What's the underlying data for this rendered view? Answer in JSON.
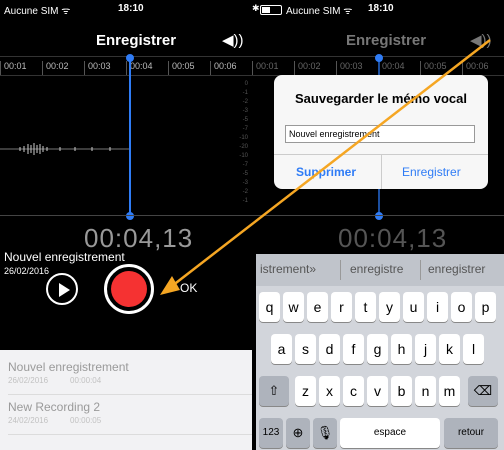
{
  "left": {
    "status": {
      "carrier": "Aucune SIM ᯤ",
      "time": "18:10"
    },
    "nav": {
      "title": "Enregistrer",
      "speaker": "◀))"
    },
    "timeline": [
      "00:01",
      "00:02",
      "00:03",
      "00:04",
      "00:05",
      "00:06"
    ],
    "scale": [
      "0",
      "-1",
      "-2",
      "-3",
      "-5",
      "-7",
      "-10",
      "-20",
      "-10",
      "-7",
      "-5",
      "-3",
      "-2",
      "-1",
      "0"
    ],
    "elapsed": "00:04,13",
    "recording": {
      "title": "Nouvel enregistrement",
      "date": "26/02/2016"
    },
    "ok_label": "OK",
    "list": [
      {
        "title": "Nouvel enregistrement",
        "date": "26/02/2016",
        "duration": "00:00:04"
      },
      {
        "title": "New Recording 2",
        "date": "24/02/2016",
        "duration": "00:00:05"
      }
    ]
  },
  "right": {
    "status": {
      "carrier": "Aucune SIM ᯤ",
      "time": "18:10"
    },
    "nav": {
      "title": "Enregistrer",
      "speaker": "◀))"
    },
    "timeline": [
      "00:01",
      "00:02",
      "00:03",
      "00:04",
      "00:05",
      "00:06"
    ],
    "elapsed": "00:04,13",
    "dialog": {
      "title": "Sauvegarder le mémo vocal",
      "field_value": "Nouvel enregistrement",
      "delete_label": "Supprimer",
      "save_label": "Enregistrer"
    },
    "keyboard": {
      "suggestions": [
        "istrement»",
        "enregistre",
        "enregistrer"
      ],
      "row1": [
        "q",
        "w",
        "e",
        "r",
        "t",
        "y",
        "u",
        "i",
        "o",
        "p"
      ],
      "row2": [
        "a",
        "s",
        "d",
        "f",
        "g",
        "h",
        "j",
        "k",
        "l"
      ],
      "row3": [
        "z",
        "x",
        "c",
        "v",
        "b",
        "n",
        "m"
      ],
      "numbers_label": "123",
      "space_label": "espace",
      "return_label": "retour"
    }
  },
  "icons": [
    "wifi-icon",
    "bluetooth-icon",
    "battery-icon",
    "speaker-icon",
    "play-icon",
    "record-icon",
    "globe-icon",
    "microphone-icon",
    "shift-icon",
    "backspace-icon",
    "arrow-annotation"
  ],
  "colors": {
    "accent": "#2f7cf6",
    "record": "#f53232",
    "arrow": "#f5a623"
  }
}
